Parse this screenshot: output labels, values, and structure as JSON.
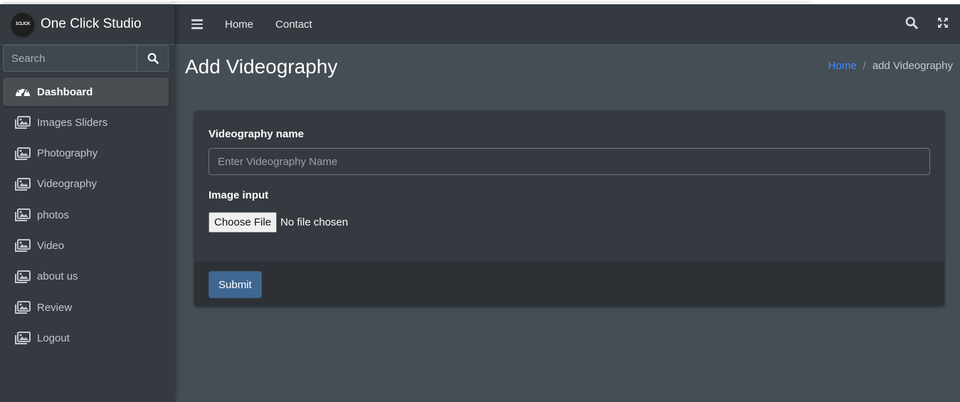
{
  "brand": {
    "name": "One Click Studio",
    "logo_text": "1CLICK"
  },
  "sidebar_search": {
    "placeholder": "Search"
  },
  "sidebar": {
    "items": [
      {
        "label": "Dashboard",
        "icon": "dashboard-icon",
        "active": true
      },
      {
        "label": "Images Sliders",
        "icon": "images-icon"
      },
      {
        "label": "Photography",
        "icon": "images-icon"
      },
      {
        "label": "Videography",
        "icon": "images-icon"
      },
      {
        "label": "photos",
        "icon": "images-icon"
      },
      {
        "label": "Video",
        "icon": "images-icon"
      },
      {
        "label": "about us",
        "icon": "images-icon"
      },
      {
        "label": "Review",
        "icon": "images-icon"
      },
      {
        "label": "Logout",
        "icon": "images-icon"
      }
    ]
  },
  "topnav": {
    "links": [
      "Home",
      "Contact"
    ],
    "icons": [
      "hamburger-menu-icon",
      "search-icon",
      "fullscreen-expand-icon"
    ]
  },
  "page": {
    "title": "Add Videography",
    "breadcrumb": {
      "home": "Home",
      "separator": "/",
      "current": "add Videography"
    }
  },
  "form": {
    "name_label": "Videography name",
    "name_placeholder": "Enter Videography Name",
    "name_value": "",
    "image_label": "Image input",
    "file_button": "Choose File",
    "file_status": "No file chosen",
    "submit_label": "Submit"
  },
  "colors": {
    "sidebar_bg": "#343a40",
    "content_bg": "#454d55",
    "link_blue": "#3f8cff",
    "submit_bg": "#3f6791"
  }
}
